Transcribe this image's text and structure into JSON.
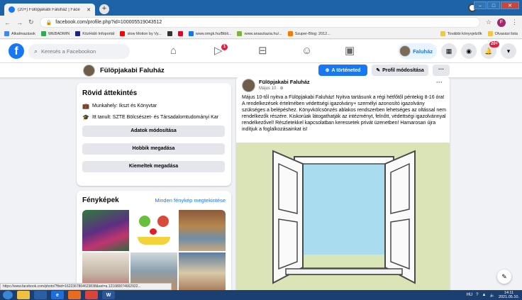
{
  "browser": {
    "tab_title": "(20+) Fülöpjakabi Faluház | Face",
    "tab_close": "✕",
    "new_tab": "+",
    "url": "facebook.com/profile.php?id=100005519043512",
    "bookmarks": [
      {
        "label": "Alkalmazások",
        "color": "#4285f4"
      },
      {
        "label": "WEBADMIN",
        "color": "#34a853"
      },
      {
        "label": "KözHáló Infoportál",
        "color": "#1a237e"
      },
      {
        "label": "slow Motion by Vy...",
        "color": "#ff0000"
      },
      {
        "label": "",
        "color": "#333333"
      },
      {
        "label": "",
        "color": "#e60023"
      },
      {
        "label": "www.omgk.hu/Bibli...",
        "color": "#1a73e8"
      },
      {
        "label": "www.anasztazia.hu/...",
        "color": "#7cb342"
      },
      {
        "label": "Szuper-Blog: 2012...",
        "color": "#f57c00"
      }
    ],
    "bookmarks_right": [
      "További könyvjelzők",
      "Olvasási lista"
    ],
    "status_url": "https://www.facebook.com/photo/?fbid=1622367804623838&set=a.121680074662922..."
  },
  "fb": {
    "search_placeholder": "Keresés a Facebookon",
    "watch_badge": "1",
    "user_name": "Faluház",
    "notif_badge": "20+"
  },
  "profile": {
    "name": "Fülöpjakabi Faluház",
    "add_story": "A történeted",
    "edit_profile": "Profil módosítása",
    "more": "···"
  },
  "intro": {
    "title": "Rövid áttekintés",
    "work": "Munkahely: Ikszt és Könyvtar",
    "study": "Itt tanult: SZTE Bölcsészet- és Társadalomtudományi Kar",
    "buttons": [
      "Adatok módosítása",
      "Hobbik megadása",
      "Kiemeltek megadása"
    ]
  },
  "photos": {
    "title": "Fényképek",
    "see_all": "Minden fénykép megtekintése"
  },
  "post": {
    "author": "Fülöpjakabi Faluház",
    "date": "Május 10 · ⊕",
    "more": "···",
    "text": "Május 10-től nyitva a Fülöpjakabi Faluház! Nyitva tartásunk a régi hétfőtől péntekig 8-16 óra! A rendelkezések értelmében védettségi igazolvány+ személyi azonosító igazolvány szükséges a belépéshez. Könyvkölcsönzés ablakos rendszerben lehetséges az oltással nem rendelkezők részére. Kiskorúak látogathatják az intézményt, felnőtt, védettségi igazolvánnyal rendelkezővel! Részletekkel kapcsolatban keressetek privát üzenetben! Hamarosan újra indítjuk a foglalkozásainkat is!"
  },
  "taskbar": {
    "lang": "HU",
    "time": "14:11",
    "date": "2021.05.10."
  }
}
